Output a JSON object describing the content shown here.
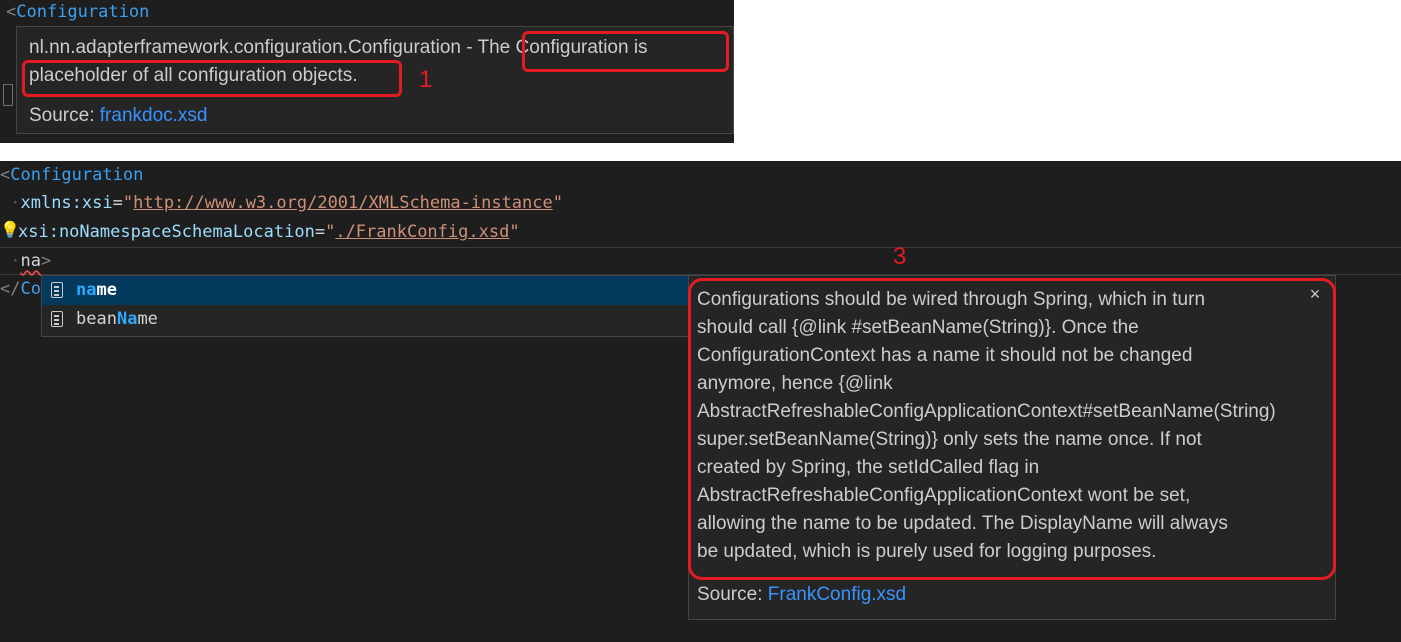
{
  "top": {
    "code_tag": "Configuration",
    "hover": {
      "line1": "nl.nn.adapterframework.configuration.Configuration - The Configuration is",
      "line2": "placeholder of all configuration objects.",
      "source_label": "Source: ",
      "source_link": "frankdoc.xsd"
    },
    "annotation_number": "1"
  },
  "bottom": {
    "code": {
      "line1_tag": "Configuration",
      "line2_attr": "xmlns:xsi",
      "line2_value": "http://www.w3.org/2001/XMLSchema-instance",
      "line3_attr": "xsi:noNamespaceSchemaLocation",
      "line3_value": "./FrankConfig.xsd",
      "line4_typed": "na",
      "line5_closing": "Co"
    },
    "suggestions": [
      {
        "match": "na",
        "rest": "me",
        "prefix": ""
      },
      {
        "prefix": "bean",
        "match": "Na",
        "rest": "me"
      }
    ],
    "detail": {
      "lines": [
        "Configurations should be wired through Spring, which in turn",
        "should call {@link #setBeanName(String)}. Once the",
        "ConfigurationContext has a name it should not be changed",
        "anymore, hence {@link",
        "AbstractRefreshableConfigApplicationContext#setBeanName(String)",
        "super.setBeanName(String)} only sets the name once. If not",
        "created by Spring, the setIdCalled flag in",
        "AbstractRefreshableConfigApplicationContext wont be set,",
        "allowing the name to be updated. The DisplayName will always",
        "be updated, which is purely used for logging purposes."
      ],
      "close_glyph": "×",
      "source_label": "Source: ",
      "source_link": "FrankConfig.xsd"
    },
    "annotation_number": "3"
  },
  "colors": {
    "editor_bg": "#1e1e1e",
    "widget_bg": "#252526",
    "selected_bg": "#04395e",
    "annotation_red": "#e31b23",
    "link_blue": "#3794ff"
  }
}
